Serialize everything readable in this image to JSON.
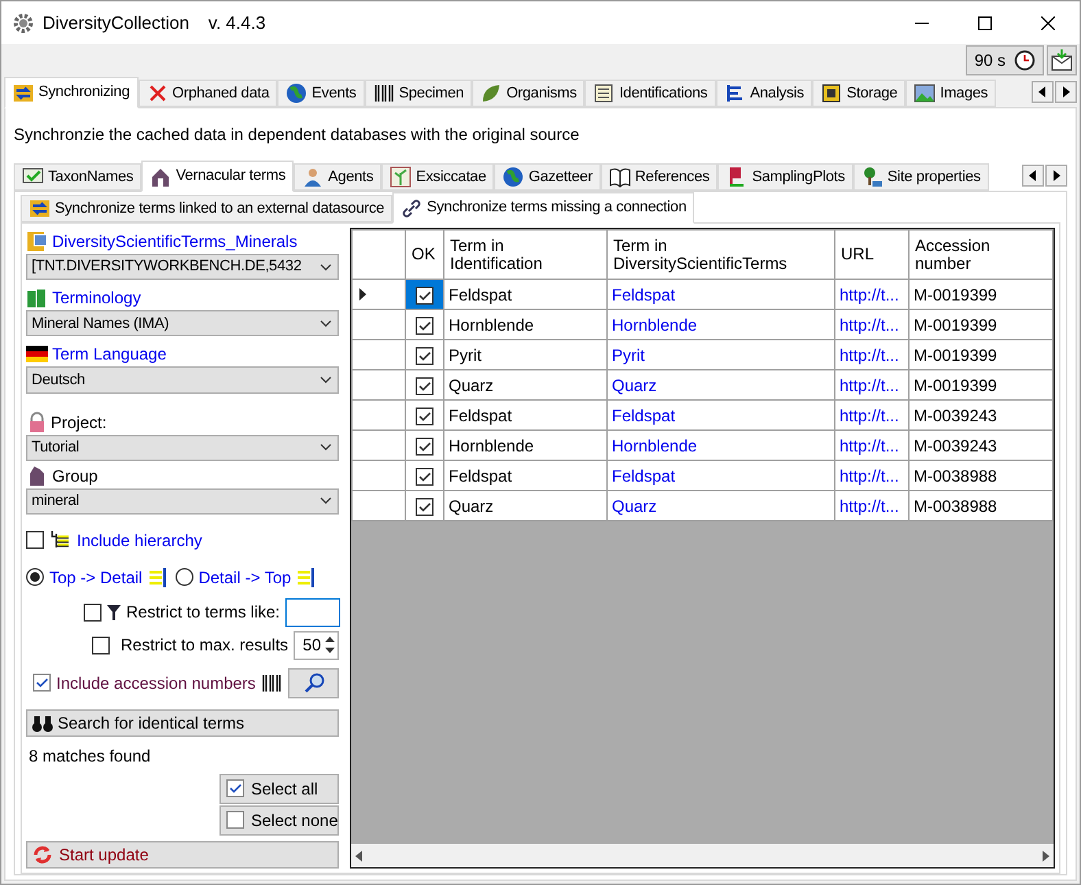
{
  "window": {
    "title": "DiversityCollection",
    "version": "v. 4.4.3"
  },
  "toolbar": {
    "timer": "90 s"
  },
  "main_tabs": [
    {
      "label": "Synchronizing",
      "selected": true
    },
    {
      "label": "Orphaned data",
      "selected": false
    },
    {
      "label": "Events",
      "selected": false
    },
    {
      "label": "Specimen",
      "selected": false
    },
    {
      "label": "Organisms",
      "selected": false
    },
    {
      "label": "Identifications",
      "selected": false
    },
    {
      "label": "Analysis",
      "selected": false
    },
    {
      "label": "Storage",
      "selected": false
    },
    {
      "label": "Images",
      "selected": false
    }
  ],
  "description": "Synchronzie the cached data in dependent databases with the original source",
  "sub_tabs": [
    {
      "label": "TaxonNames",
      "selected": false
    },
    {
      "label": "Vernacular terms",
      "selected": true
    },
    {
      "label": "Agents",
      "selected": false
    },
    {
      "label": "Exsiccatae",
      "selected": false
    },
    {
      "label": "Gazetteer",
      "selected": false
    },
    {
      "label": "References",
      "selected": false
    },
    {
      "label": "SamplingPlots",
      "selected": false
    },
    {
      "label": "Site properties",
      "selected": false
    }
  ],
  "sync_tabs": [
    {
      "label": "Synchronize terms linked to an external datasource",
      "selected": false
    },
    {
      "label": "Synchronize terms missing a connection",
      "selected": true
    }
  ],
  "settings": {
    "source": {
      "label": "DiversityScientificTerms_Minerals",
      "value": "[TNT.DIVERSITYWORKBENCH.DE,5432"
    },
    "terminology": {
      "label": "Terminology",
      "value": "Mineral Names (IMA)"
    },
    "language": {
      "label": "Term Language",
      "value": "Deutsch"
    },
    "project": {
      "label": "Project:",
      "value": "Tutorial"
    },
    "group": {
      "label": "Group",
      "value": "mineral"
    },
    "include_hierarchy": {
      "label": "Include hierarchy",
      "checked": false
    },
    "direction": [
      {
        "label": "Top -> Detail",
        "selected": true
      },
      {
        "label": "Detail -> Top",
        "selected": false
      }
    ],
    "restrict_terms": {
      "label": "Restrict to terms like:",
      "checked": false
    },
    "restrict_max": {
      "label": "Restrict to max. results",
      "checked": false,
      "value": "50"
    },
    "include_accession": {
      "label": "Include accession numbers",
      "checked": true
    },
    "search_button": "Search for identical terms",
    "matches": "8 matches found",
    "select_all": {
      "label": "Select all",
      "checked": true
    },
    "select_none": {
      "label": "Select none",
      "checked": false
    },
    "start_update": "Start update"
  },
  "table": {
    "columns": [
      "OK",
      "Term in Identification",
      "Term in DiversityScientificTerms",
      "URL",
      "Accession number"
    ],
    "rows": [
      {
        "current": true,
        "ok": true,
        "term_identification": "Feldspat",
        "term_scientific": "Feldspat",
        "url": "http://t...",
        "accession": "M-0019399"
      },
      {
        "current": false,
        "ok": true,
        "term_identification": "Hornblende",
        "term_scientific": "Hornblende",
        "url": "http://t...",
        "accession": "M-0019399"
      },
      {
        "current": false,
        "ok": true,
        "term_identification": "Pyrit",
        "term_scientific": "Pyrit",
        "url": "http://t...",
        "accession": "M-0019399"
      },
      {
        "current": false,
        "ok": true,
        "term_identification": "Quarz",
        "term_scientific": "Quarz",
        "url": "http://t...",
        "accession": "M-0019399"
      },
      {
        "current": false,
        "ok": true,
        "term_identification": "Feldspat",
        "term_scientific": "Feldspat",
        "url": "http://t...",
        "accession": "M-0039243"
      },
      {
        "current": false,
        "ok": true,
        "term_identification": "Hornblende",
        "term_scientific": "Hornblende",
        "url": "http://t...",
        "accession": "M-0039243"
      },
      {
        "current": false,
        "ok": true,
        "term_identification": "Feldspat",
        "term_scientific": "Feldspat",
        "url": "http://t...",
        "accession": "M-0038988"
      },
      {
        "current": false,
        "ok": true,
        "term_identification": "Quarz",
        "term_scientific": "Quarz",
        "url": "http://t...",
        "accession": "M-0038988"
      }
    ]
  }
}
